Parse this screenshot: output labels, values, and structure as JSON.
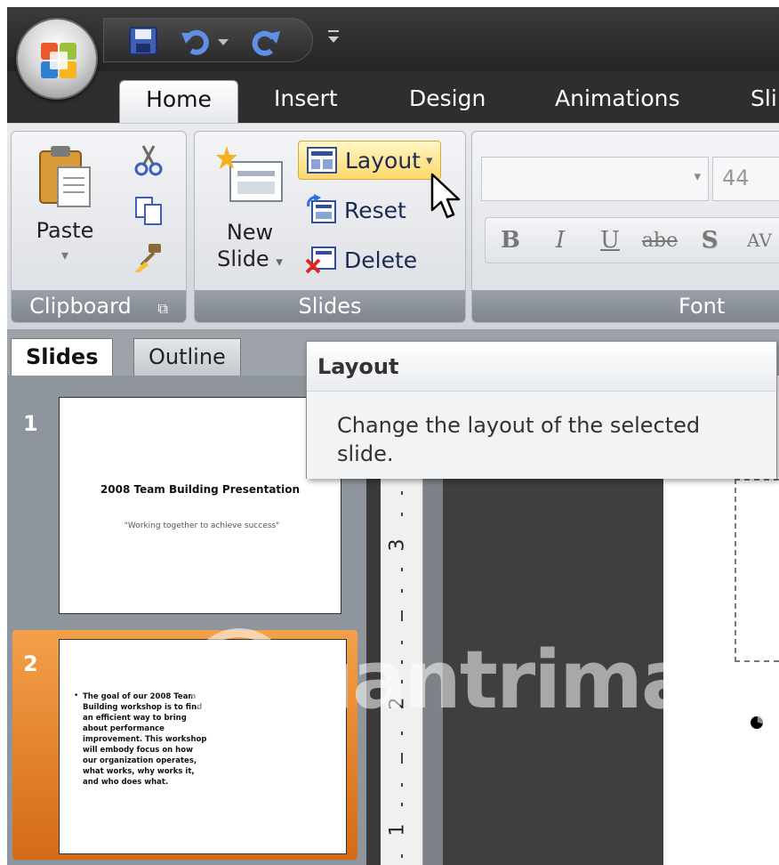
{
  "tabs": [
    {
      "label": "Home",
      "active": true
    },
    {
      "label": "Insert",
      "active": false
    },
    {
      "label": "Design",
      "active": false
    },
    {
      "label": "Animations",
      "active": false
    },
    {
      "label": "Sli",
      "active": false
    }
  ],
  "clipboard": {
    "paste_label": "Paste",
    "paste_arrow": "▾",
    "group_label": "Clipboard",
    "launcher": "⧉"
  },
  "slides_group": {
    "new_slide_line1": "New",
    "new_slide_line2": "Slide",
    "new_slide_arrow": "▾",
    "layout_label": "Layout",
    "layout_arrow": "▾",
    "reset_label": "Reset",
    "delete_label": "Delete",
    "group_label": "Slides"
  },
  "font_group": {
    "font_name": "",
    "font_arrow": "▾",
    "font_size": "44",
    "bold": "B",
    "italic": "I",
    "underline": "U",
    "strike": "abe",
    "shadow": "S",
    "spacing": "AV",
    "group_label": "Font"
  },
  "pane_tabs": {
    "slides": "Slides",
    "outline": "Outline"
  },
  "thumbnails": [
    {
      "number": "1",
      "title": "2008 Team Building Presentation",
      "subtitle": "\"Working together to achieve success\""
    },
    {
      "number": "2",
      "body": "The goal of our 2008 Team Building workshop is to find an efficient way to bring about performance improvement. This workshop will embody focus on how our organization operates, what works, why works it, and who does what."
    }
  ],
  "ruler": {
    "mark_3": "3",
    "mark_2": "2",
    "mark_1": "1"
  },
  "tooltip": {
    "title": "Layout",
    "description": "Change the layout of the selected slide."
  },
  "watermark": {
    "text": "uantrimang"
  },
  "colors": {
    "ribbon_bg": "#dadde2",
    "group_label_bg": "#8a9098",
    "layout_hover": "#ffd86a",
    "selected_thumb": "#e07a22",
    "app_dark": "#2e2e2e"
  }
}
